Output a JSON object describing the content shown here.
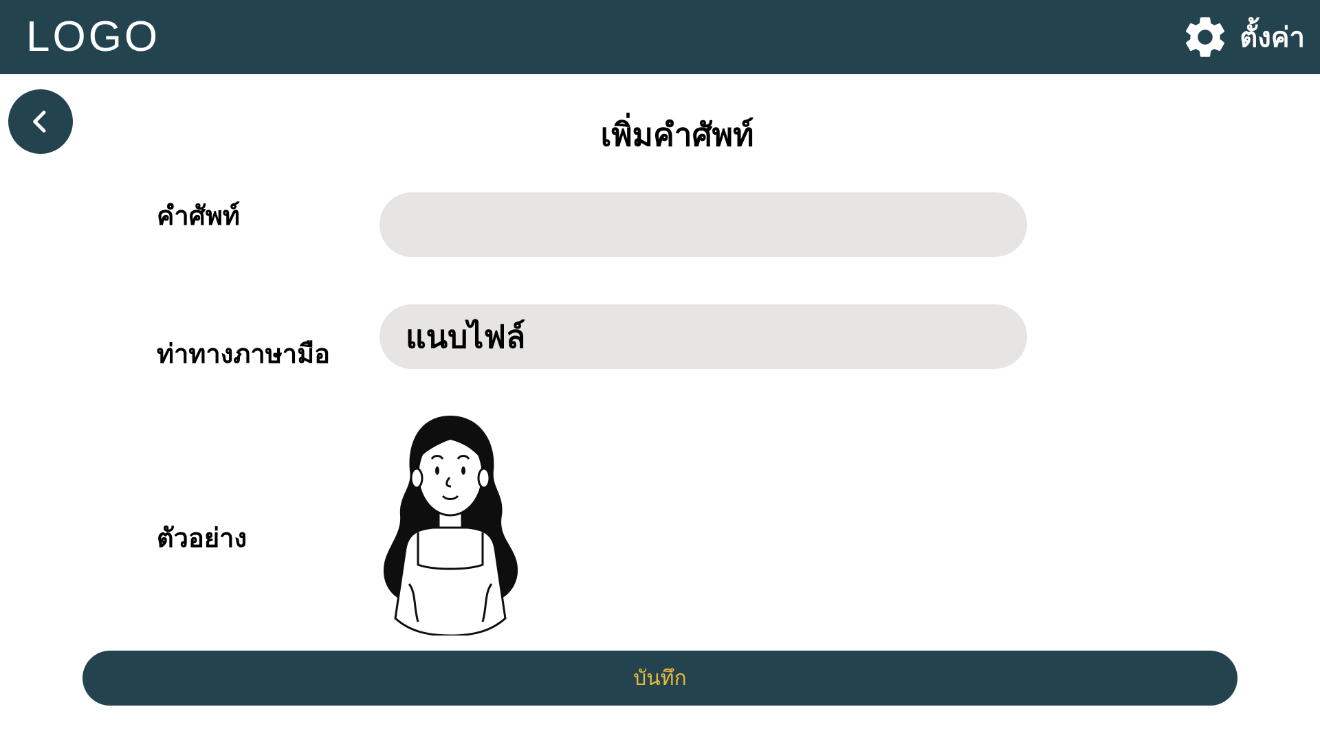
{
  "header": {
    "logo_text": "LOGO",
    "settings_label": "ตั้งค่า",
    "settings_icon": "gear-icon"
  },
  "back_icon": "chevron-left-icon",
  "page": {
    "title": "เพิ่มคำศัพท์"
  },
  "form": {
    "word_label": "คำศัพท์",
    "word_value": "",
    "sign_label": "ท่าทางภาษามือ",
    "sign_file_text": "แนบไฟล์",
    "example_label": "ตัวอย่าง"
  },
  "save_label": "บันทึก",
  "colors": {
    "primary": "#23434f",
    "input_bg": "#e6e5e3",
    "save_text": "#e8b93a"
  }
}
